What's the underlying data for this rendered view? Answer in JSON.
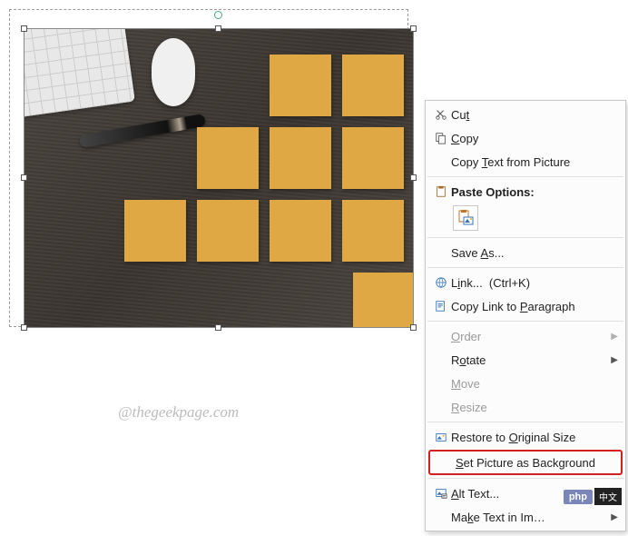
{
  "watermark": "@thegeekpage.com",
  "menu": {
    "cut": "Cut",
    "copy": "Copy",
    "copy_text": "Copy Text from Picture",
    "paste_options": "Paste Options:",
    "save_as": "Save As...",
    "link": "Link...  (Ctrl+K)",
    "copy_link_para": "Copy Link to Paragraph",
    "order": "Order",
    "rotate": "Rotate",
    "move": "Move",
    "resize": "Resize",
    "restore": "Restore to Original Size",
    "set_bg": "Set Picture as Background",
    "alt_text": "Alt Text...",
    "make_text": "Make Text in Image …"
  },
  "underlines": {
    "cut": "t",
    "copy": "C",
    "copy_text": "T",
    "save_as": "A",
    "link": "i",
    "copy_link_para": "P",
    "order": "O",
    "rotate": "O",
    "move": "M",
    "resize": "R",
    "restore": "O",
    "set_bg": "S",
    "alt_text": "A",
    "make_text": "k"
  },
  "badges": {
    "php": "php",
    "cn": "中文"
  }
}
